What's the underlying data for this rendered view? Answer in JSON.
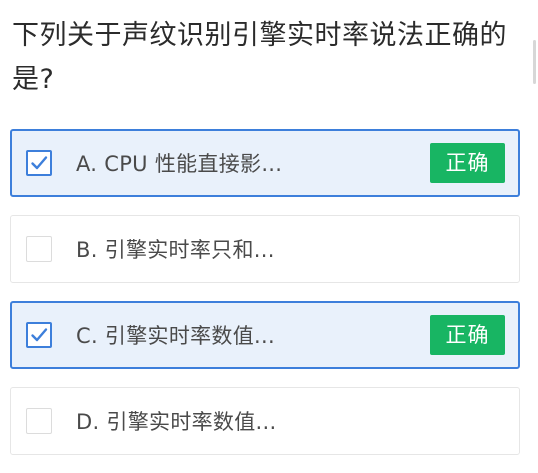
{
  "question": {
    "text": "下列关于声纹识别引擎实时率说法正确的是?"
  },
  "options": [
    {
      "label": "A. CPU 性能直接影...",
      "checked": true,
      "badge": "正确"
    },
    {
      "label": "B. 引擎实时率只和...",
      "checked": false,
      "badge": ""
    },
    {
      "label": "C. 引擎实时率数值...",
      "checked": true,
      "badge": "正确"
    },
    {
      "label": "D. 引擎实时率数值...",
      "checked": false,
      "badge": ""
    }
  ],
  "colors": {
    "accent": "#3d7fdb",
    "correct_badge": "#18b563",
    "checked_background": "#e9f1fb"
  },
  "icons": {
    "checkbox_checked": "check-icon"
  }
}
